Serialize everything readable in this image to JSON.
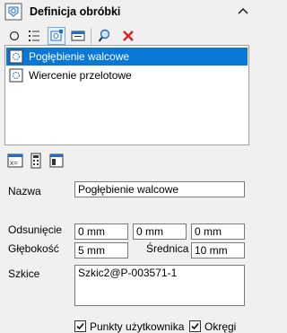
{
  "panel": {
    "title": "Definicja obróbki"
  },
  "toolbar": {
    "icons": [
      "circle-icon",
      "list-icon",
      "cylinder-settings-icon",
      "collapse-list-icon",
      "search-icon",
      "delete-icon"
    ]
  },
  "operations": [
    {
      "label": "Pogłębienie walcowe",
      "selected": true
    },
    {
      "label": "Wiercenie przelotowe",
      "selected": false
    }
  ],
  "form": {
    "name_label": "Nazwa",
    "name_value": "Pogłębienie walcowe",
    "offset_label": "Odsunięcie",
    "offset_values": [
      "0 mm",
      "0 mm",
      "0 mm"
    ],
    "depth_label": "Głębokość",
    "depth_value": "5 mm",
    "diameter_label": "Średnica",
    "diameter_value": "10 mm",
    "sketches_label": "Szkice",
    "sketches_value": "Szkic2@P-003571-1",
    "user_points_label": "Punkty użytkownika",
    "user_points_checked": true,
    "circles_label": "Okręgi",
    "circles_checked": true
  },
  "colors": {
    "selection": "#0a78d7",
    "delete": "#e02020",
    "accent": "#1e6fc0"
  }
}
